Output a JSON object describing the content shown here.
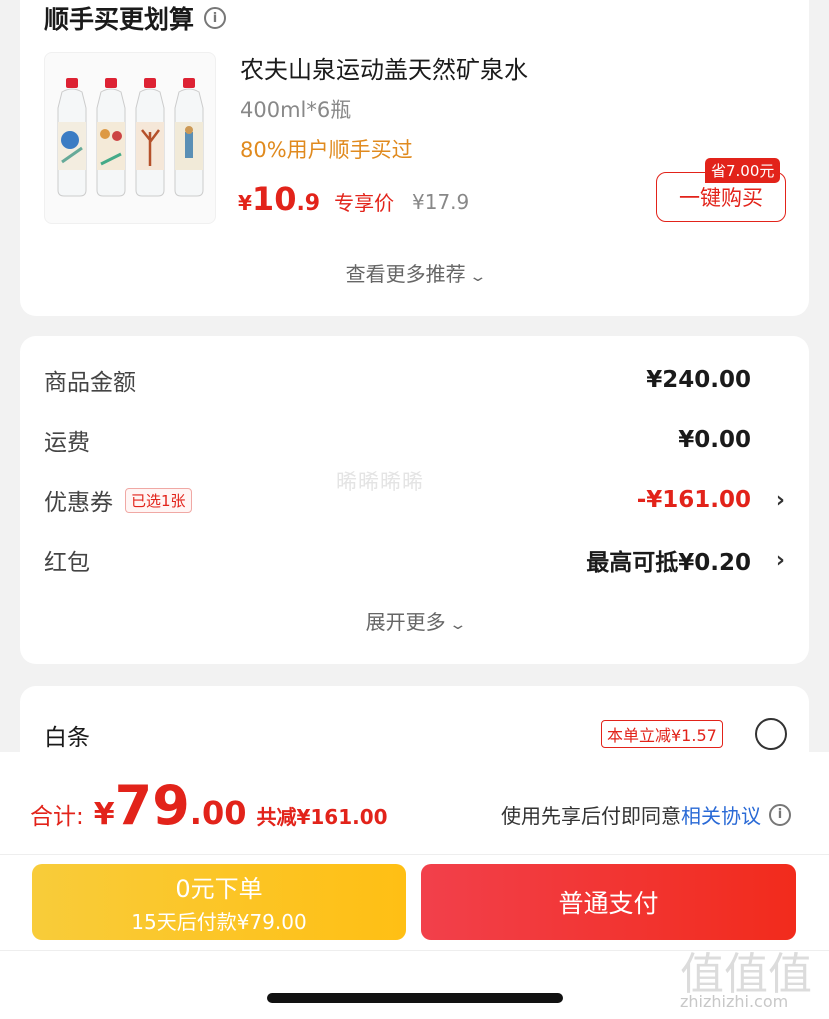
{
  "recommendation": {
    "title": "顺手买更划算",
    "product": {
      "name": "农夫山泉运动盖天然矿泉水",
      "spec": "400ml*6瓶",
      "popularity": "80%用户顺手买过",
      "price_symbol": "¥",
      "price_int": "10",
      "price_dec": ".9",
      "price_tag": "专享价",
      "original_price": "¥17.9",
      "save_badge": "省7.00元",
      "buy_label": "一键购买"
    },
    "more_label": "查看更多推荐"
  },
  "summary": {
    "goods": {
      "label": "商品金额",
      "value": "¥240.00"
    },
    "shipping": {
      "label": "运费",
      "value": "¥0.00"
    },
    "coupon": {
      "label": "优惠券",
      "tag": "已选1张",
      "value": "-¥161.00"
    },
    "redpacket": {
      "label": "红包",
      "value": "最高可抵¥0.20"
    },
    "watermark": "晞晞晞晞",
    "expand_label": "展开更多"
  },
  "baitiao": {
    "label": "白条",
    "promo": "本单立减¥1.57"
  },
  "bottom": {
    "total_label": "合计:",
    "total_symbol": "¥",
    "total_int": "79",
    "total_dec": ".00",
    "total_discount": "共减¥161.00",
    "agree_text": "使用先享后付即同意",
    "agree_link": "相关协议",
    "later_line1": "0元下单",
    "later_line2": "15天后付款¥79.00",
    "pay_label": "普通支付"
  },
  "watermark_logo": {
    "text": "值值值",
    "url": "zhizhizhi.com"
  },
  "colors": {
    "accent_red": "#e2231a",
    "popular_orange": "#e08a1e",
    "later_yellow": "#ffbf14",
    "link_blue": "#2a6ad6"
  }
}
